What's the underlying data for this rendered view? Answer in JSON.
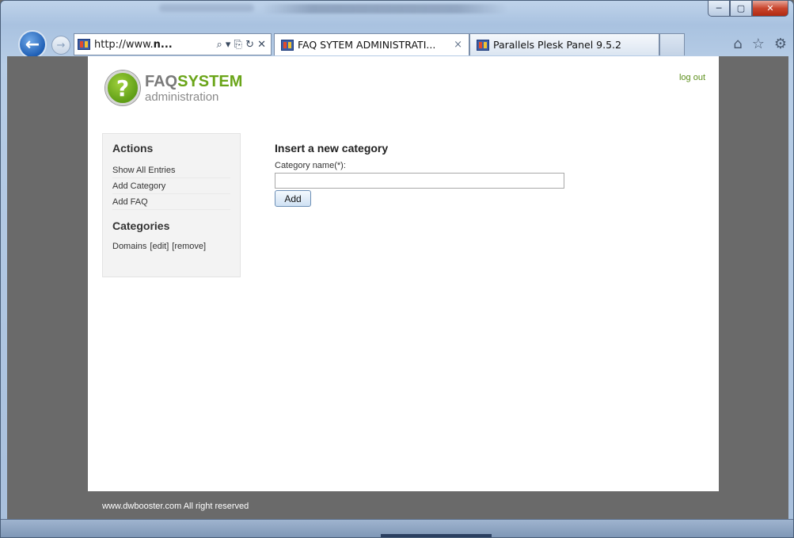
{
  "browser": {
    "address": {
      "url_prefix": "http://www.",
      "url_bold": "n...",
      "icons": "⌕ ▾ ⎘ ↻ ✕"
    },
    "tabs": [
      {
        "label": "FAQ SYTEM ADMINISTRATI...",
        "close": "×"
      },
      {
        "label": "Parallels Plesk Panel 9.5.2"
      }
    ],
    "window_buttons": {
      "minimize": "─",
      "maximize": "▢",
      "close": "✕"
    },
    "right_icons": [
      "⌂",
      "☆",
      "⚙"
    ]
  },
  "page": {
    "logo": {
      "faq": "FAQ",
      "system": "SYSTEM",
      "subtitle": "administration",
      "glyph": "?"
    },
    "logout": "log out",
    "sidebar": {
      "actions_title": "Actions",
      "actions": [
        "Show All Entries",
        "Add Category",
        "Add FAQ"
      ],
      "categories_title": "Categories",
      "categories": [
        {
          "name": "Domains",
          "edit": "[edit]",
          "remove": "[remove]"
        }
      ]
    },
    "main": {
      "title": "Insert a new category",
      "field_label": "Category name(*):",
      "field_value": "",
      "button": "Add"
    },
    "footer": "www.dwbooster.com All right reserved"
  },
  "colors": {
    "accent_green": "#6aa519",
    "link_green": "#5d8f1c",
    "page_bg": "#6a6a6a"
  }
}
